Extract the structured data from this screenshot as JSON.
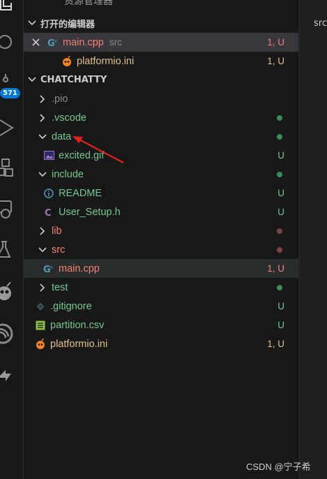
{
  "explorer": {
    "title_partial": "资源管理器",
    "open_editors_header": "打开的编辑器",
    "open_editors": [
      {
        "name": "main.cpp",
        "dir": "src",
        "status": "1, U"
      },
      {
        "name": "platformio.ini",
        "status": "1, U"
      }
    ],
    "project_header": "CHATCHATTY",
    "tree": [
      {
        "label": ".pio"
      },
      {
        "label": ".vscode"
      },
      {
        "label": "data"
      },
      {
        "label": "excited.gif",
        "status": "U"
      },
      {
        "label": "include"
      },
      {
        "label": "README",
        "status": "U"
      },
      {
        "label": "User_Setup.h",
        "status": "U"
      },
      {
        "label": "lib"
      },
      {
        "label": "src"
      },
      {
        "label": "main.cpp",
        "status": "1, U"
      },
      {
        "label": "test"
      },
      {
        "label": ".gitignore",
        "status": "U"
      },
      {
        "label": "partition.csv",
        "status": "U"
      },
      {
        "label": "platformio.ini",
        "status": "1, U"
      }
    ]
  },
  "activity_bar": {
    "source_control_badge": "571",
    "icons": [
      "explorer-icon",
      "search-icon",
      "source-control-icon",
      "run-debug-icon",
      "extensions-icon",
      "remote-explorer-icon",
      "testing-icon",
      "platformio-icon",
      "esp-icon",
      "deploy-icon"
    ]
  },
  "editor": {
    "partial_text": "src"
  },
  "watermark": "CSDN @宁子希",
  "colors": {
    "untracked_green": "#73c991",
    "error_red": "#f88070",
    "modified_yellow": "#e2c08d",
    "badge_blue": "#0078d4",
    "annotation_arrow": "#e0231b"
  }
}
